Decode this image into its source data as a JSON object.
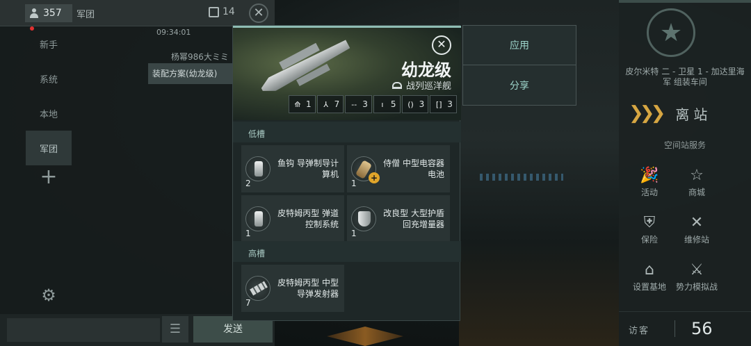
{
  "chat": {
    "online_count": "357",
    "channel_title": "军团",
    "message_count": "14",
    "close_symbol": "✕",
    "tabs": [
      "新手",
      "系统",
      "本地",
      "军团"
    ],
    "plus_symbol": "+",
    "timestamp": "09:34:01",
    "sender": "杨幂986大ミミ",
    "message": "装配方案(幼龙级)",
    "input_placeholder": "",
    "menu_symbol": "☰",
    "send_label": "发送"
  },
  "fitting": {
    "close_symbol": "✕",
    "ship_name": "幼龙级",
    "ship_class": "战列巡洋舰",
    "stats": [
      {
        "glyph": "⟰",
        "value": "1"
      },
      {
        "glyph": "⅄",
        "value": "7"
      },
      {
        "glyph": "--",
        "value": "3"
      },
      {
        "glyph": "ı",
        "value": "5"
      },
      {
        "glyph": "()",
        "value": "3"
      },
      {
        "glyph": "[]",
        "value": "3"
      }
    ],
    "low_slot_title": "低槽",
    "high_slot_title": "高槽",
    "low_slots": [
      {
        "qty": "2",
        "name": "鱼钩 导弹制导计算机",
        "icon": "missile-guidance-icon"
      },
      {
        "qty": "1",
        "name": "侍僧 中型电容器电池",
        "icon": "capacitor-battery-icon"
      },
      {
        "qty": "1",
        "name": "皮特姆丙型 弹道控制系统",
        "icon": "ballistic-control-icon"
      },
      {
        "qty": "1",
        "name": "改良型 大型护盾回充增量器",
        "icon": "shield-recharger-icon"
      }
    ],
    "high_slots": [
      {
        "qty": "7",
        "name": "皮特姆丙型 中型导弹发射器",
        "icon": "missile-launcher-icon"
      }
    ]
  },
  "actions": {
    "apply": "应用",
    "share": "分享"
  },
  "station": {
    "location": "皮尔米特 二 - 卫星 1 - 加达里海军 组装车间",
    "undock": "离站",
    "services_title": "空间站服务",
    "buttons": [
      {
        "label": "活动",
        "icon": "activity-icon"
      },
      {
        "label": "商城",
        "icon": "store-icon"
      },
      {
        "label": "保险",
        "icon": "insurance-icon"
      },
      {
        "label": "维修站",
        "icon": "repair-icon"
      },
      {
        "label": "设置基地",
        "icon": "set-home-icon"
      },
      {
        "label": "势力模拟战",
        "icon": "faction-sim-icon"
      }
    ],
    "visitor_label": "访客",
    "visitor_count": "56"
  }
}
